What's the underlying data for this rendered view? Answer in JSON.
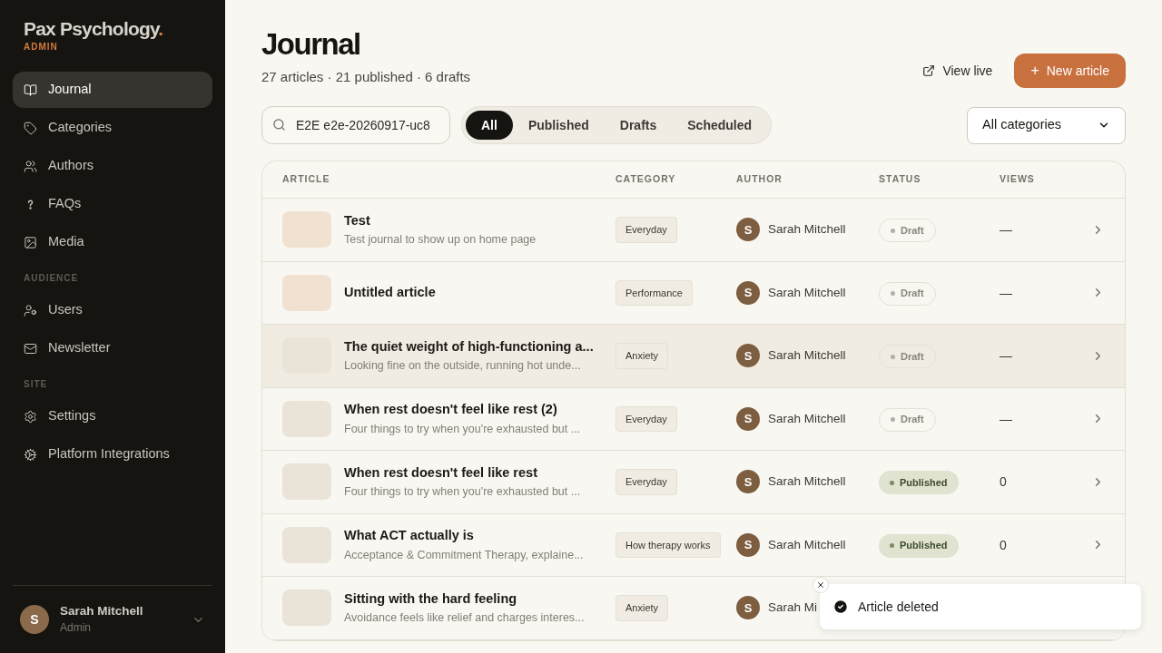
{
  "brand": {
    "name": "Pax Psychology",
    "dot": ".",
    "tag": "ADMIN"
  },
  "sidebar": {
    "sections": [
      {
        "items": [
          {
            "label": "Journal",
            "selected": true
          },
          {
            "label": "Categories",
            "selected": false
          },
          {
            "label": "Authors",
            "selected": false
          },
          {
            "label": "FAQs",
            "selected": false
          },
          {
            "label": "Media",
            "selected": false
          }
        ]
      },
      {
        "heading": "AUDIENCE",
        "items": [
          {
            "label": "Users",
            "selected": false
          },
          {
            "label": "Newsletter",
            "selected": false
          }
        ]
      },
      {
        "heading": "SITE",
        "items": [
          {
            "label": "Settings",
            "selected": false
          },
          {
            "label": "Platform Integrations",
            "selected": false
          }
        ]
      }
    ],
    "user": {
      "initial": "S",
      "name": "Sarah Mitchell",
      "role": "Admin"
    }
  },
  "page": {
    "title": "Journal",
    "summary": "27 articles · 21 published · 6 drafts",
    "view_live": "View live",
    "new_article": "+",
    "new_article_label": "New article"
  },
  "search": {
    "value": "E2E e2e-20260917-uc8"
  },
  "filters": [
    {
      "label": "All",
      "selected": true
    },
    {
      "label": "Published",
      "selected": false
    },
    {
      "label": "Drafts",
      "selected": false
    },
    {
      "label": "Scheduled",
      "selected": false
    }
  ],
  "category_select": {
    "value": "All categories"
  },
  "table": {
    "columns": [
      "ARTICLE",
      "CATEGORY",
      "AUTHOR",
      "STATUS",
      "VIEWS"
    ],
    "rows": [
      {
        "title": "Test",
        "excerpt": "Test journal to show up on home page",
        "color": "#f1e1d0",
        "category": "Everyday",
        "author_initial": "S",
        "author": "Sarah Mitchell",
        "status": {
          "kind": "draft",
          "label": "Draft"
        },
        "views": "—",
        "highlighted": false
      },
      {
        "title": "Untitled article",
        "color": "#f1e1d0",
        "category": "Performance",
        "author_initial": "S",
        "author": "Sarah Mitchell",
        "status": {
          "kind": "draft",
          "label": "Draft"
        },
        "views": "—",
        "highlighted": false
      },
      {
        "title": "The quiet weight of high-functioning a...",
        "excerpt": "Looking fine on the outside, running hot unde...",
        "color": "#e9e3d8",
        "category": "Anxiety",
        "author_initial": "S",
        "author": "Sarah Mitchell",
        "status": {
          "kind": "draft",
          "label": "Draft"
        },
        "views": "—",
        "highlighted": true
      },
      {
        "title": "When rest doesn't feel like rest (2)",
        "excerpt": "Four things to try when you're exhausted but ...",
        "color": "#e9e3d8",
        "category": "Everyday",
        "author_initial": "S",
        "author": "Sarah Mitchell",
        "status": {
          "kind": "draft",
          "label": "Draft"
        },
        "views": "—",
        "highlighted": false
      },
      {
        "title": "When rest doesn't feel like rest",
        "excerpt": "Four things to try when you're exhausted but ...",
        "color": "#e9e3d8",
        "category": "Everyday",
        "author_initial": "S",
        "author": "Sarah Mitchell",
        "status": {
          "kind": "published",
          "label": "Published"
        },
        "views": "0",
        "highlighted": false
      },
      {
        "title": "What ACT actually is",
        "excerpt": "Acceptance & Commitment Therapy, explaine...",
        "color": "#e9e3d8",
        "category": "How therapy works",
        "author_initial": "S",
        "author": "Sarah Mitchell",
        "status": {
          "kind": "published",
          "label": "Published"
        },
        "views": "0",
        "highlighted": false
      },
      {
        "title": "Sitting with the hard feeling",
        "excerpt": "Avoidance feels like relief and charges interes...",
        "color": "#e9e3d8",
        "category": "Anxiety",
        "author_initial": "S",
        "author": "Sarah Mi",
        "highlighted": false
      }
    ]
  },
  "toast": {
    "message": "Article deleted"
  }
}
